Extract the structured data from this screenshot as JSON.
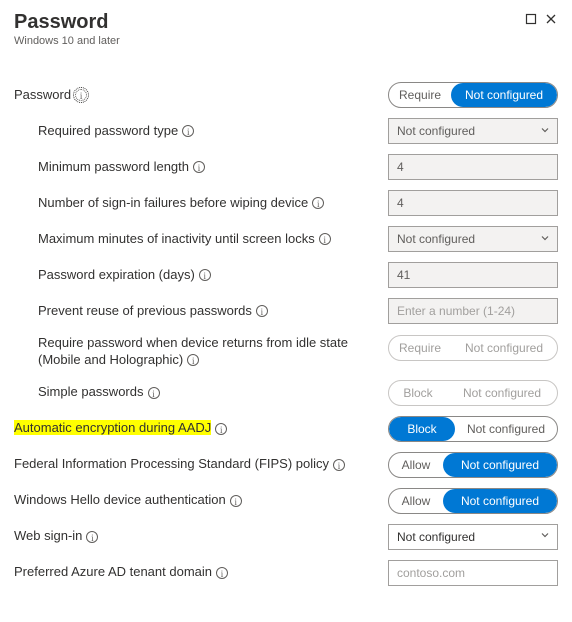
{
  "header": {
    "title": "Password",
    "subtitle": "Windows 10 and later"
  },
  "toggle_labels": {
    "require": "Require",
    "not_configured": "Not configured",
    "block": "Block",
    "allow": "Allow"
  },
  "fields": {
    "password": {
      "label": "Password",
      "value": "Not configured"
    },
    "required_type": {
      "label": "Required password type",
      "value": "Not configured"
    },
    "min_length": {
      "label": "Minimum password length",
      "value": "4"
    },
    "failures_wipe": {
      "label": "Number of sign-in failures before wiping device",
      "value": "4"
    },
    "inactivity_lock": {
      "label": "Maximum minutes of inactivity until screen locks",
      "value": "Not configured"
    },
    "expiration": {
      "label": "Password expiration (days)",
      "value": "41"
    },
    "prevent_reuse": {
      "label": "Prevent reuse of previous passwords",
      "placeholder": "Enter a number (1-24)"
    },
    "idle_return": {
      "label": "Require password when device returns from idle state (Mobile and Holographic)",
      "value": "Not configured"
    },
    "simple_pw": {
      "label": "Simple passwords",
      "value": "Not configured"
    },
    "auto_encrypt": {
      "label": "Automatic encryption during AADJ",
      "value": "Block"
    },
    "fips": {
      "label": "Federal Information Processing Standard (FIPS) policy",
      "value": "Not configured"
    },
    "hello_auth": {
      "label": "Windows Hello device authentication",
      "value": "Not configured"
    },
    "web_signin": {
      "label": "Web sign-in",
      "value": "Not configured"
    },
    "tenant_domain": {
      "label": "Preferred Azure AD tenant domain",
      "placeholder": "contoso.com"
    }
  }
}
